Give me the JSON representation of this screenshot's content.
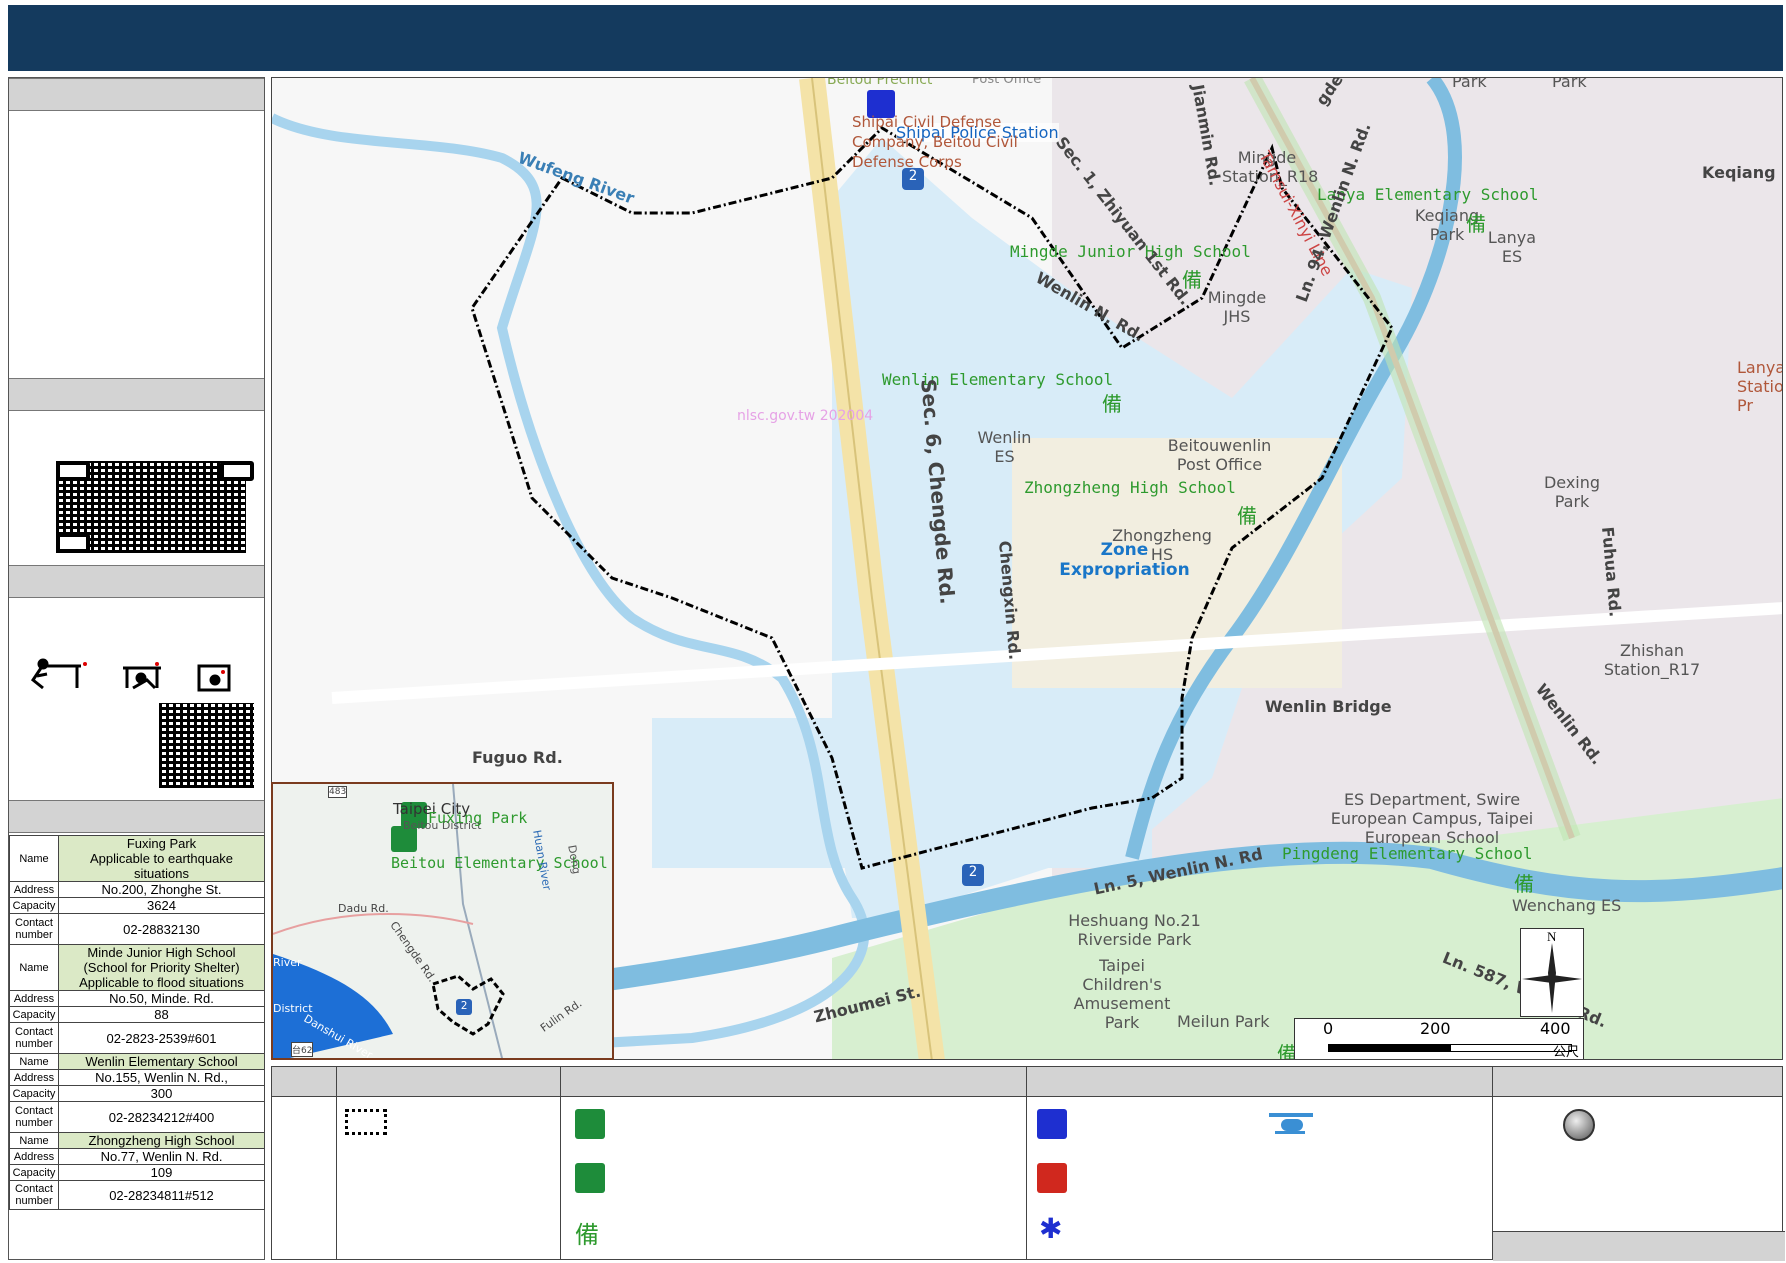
{
  "map": {
    "watermark": "nlsc.gov.tw 202004",
    "labels": {
      "beitou_precinct": "Beitou Precinct",
      "shipai_police_station": "Shipai Police Station",
      "shipai_civil_defense": "Shipai Civil Defense Company, Beitou Civil Defense Corps",
      "post_office_top": "Post Office",
      "mingde_station": "Mingde Station_R18",
      "tamsui_xinyi_line": "Tamsui-Xinyi Line",
      "lanya_elementary_school": "Lanya Elementary School",
      "keqiang_park": "Keqiang Park",
      "lanya_es": "Lanya ES",
      "keqiang_rd": "Keqiang R",
      "mingde_junior_high_school": "Mingde Junior High School",
      "mingde_jhs": "Mingde JHS",
      "zhiyuan_1st_rd": "Sec. 1, Zhiyuan 1st Rd.",
      "jianmin_rd": "Jianmin Rd.",
      "wenlin_n_rd_top": "Wenlin N. Rd.",
      "ln94_wenlin_n_rd": "Ln. 94, Wenlin N. Rd.",
      "park_top1": "Park",
      "park_top2": "Park",
      "gde_rd": "gde Rd.",
      "lanya_station": "Lanya Station Pr",
      "wenlin_elementary_school": "Wenlin Elementary School",
      "wenlin_es": "Wenlin ES",
      "beitouwenlin_post_office": "Beitouwenlin Post Office",
      "dexing_park": "Dexing Park",
      "zhongzheng_high_school": "Zhongzheng High School",
      "zhongzheng_hs": "Zhongzheng HS",
      "zone_expropriation": "Zone Expropriation",
      "chengde_rd": "Sec. 6, Chengde Rd.",
      "chengxin_rd": "Chengxin Rd.",
      "fuhua_rd": "Fuhua Rd.",
      "zhishan_station": "Zhishan Station_R17",
      "wufeng_river": "Wufeng River",
      "wenlin_bridge": "Wenlin Bridge",
      "wenlin_rd": "Wenlin Rd.",
      "fuguo_rd": "Fuguo Rd.",
      "es_department": "ES Department, Swire European Campus, Taipei European School",
      "pingdeng_elementary_school": "Pingdeng Elementary School",
      "wenchang_es": "Wenchang ES",
      "ln5_wenlin_n_rd": "Ln. 5, Wenlin N. Rd",
      "heshuang_park": "Heshuang No.21 Riverside Park",
      "taipei_childrens": "Taipei Children's Amusement Park",
      "meilun_park": "Meilun Park",
      "zhoumei_st": "Zhoumei St.",
      "ln587_wenlin_rd": "Ln. 587, Wenlin Rd.",
      "freeway_shield": "2",
      "freeway_shield2": "2"
    },
    "scale": {
      "ticks": [
        "0",
        "200",
        "400"
      ],
      "unit": "公尺"
    },
    "north": "N",
    "shelter_symbol": "備"
  },
  "inset": {
    "taipei_city": "Taipei City",
    "beitou_district": "Beitou District",
    "fuxing_park": "Fuxing Park",
    "beitou_elementary_school": "Beitou Elementary School",
    "dadu_rd": "Dadu Rd.",
    "chengde_rd": "Chengde Rd.",
    "huan_river": "Huan River",
    "danshui_river": "Danshui River",
    "fulin_rd": "Fulin Rd.",
    "district_label": "District",
    "river_label": "River",
    "road_shield": "2",
    "road_num": "483",
    "road_num2": "台62",
    "dong_label": "Dong"
  },
  "shelters": [
    {
      "name_label": "Name",
      "name": "Fuxing Park",
      "name2": "Applicable to earthquake situations",
      "address_label": "Address",
      "address": "No.200, Zhonghe St.",
      "capacity_label": "Capacity",
      "capacity": "3624",
      "contact_label": "Contact number",
      "contact": "02-28832130"
    },
    {
      "name_label": "Name",
      "name": "Minde Junior High School",
      "name2": "(School for Priority Shelter)",
      "name3": "Applicable to flood situations",
      "address_label": "Address",
      "address": "No.50, Minde. Rd.",
      "capacity_label": "Capacity",
      "capacity": "88",
      "contact_label": "Contact number",
      "contact": "02-2823-2539#601"
    },
    {
      "name_label": "Name",
      "name": "Wenlin Elementary School",
      "address_label": "Address",
      "address": "No.155, Wenlin N. Rd.,",
      "capacity_label": "Capacity",
      "capacity": "300",
      "contact_label": "Contact number",
      "contact": "02-28234212#400"
    },
    {
      "name_label": "Name",
      "name": "Zhongzheng High School",
      "address_label": "Address",
      "address": "No.77, Wenlin N. Rd.",
      "capacity_label": "Capacity",
      "capacity": "109",
      "contact_label": "Contact number",
      "contact": "02-28234811#512"
    }
  ],
  "colors": {
    "header": "#143a5e",
    "panel_gray": "#d3d3d3",
    "shelter_green": "#1e8c3a",
    "police_blue": "#1e2fd0",
    "fire_red": "#d0281e",
    "river_blue": "#a8d4ee",
    "zone_blue": "#d8ecf8"
  }
}
